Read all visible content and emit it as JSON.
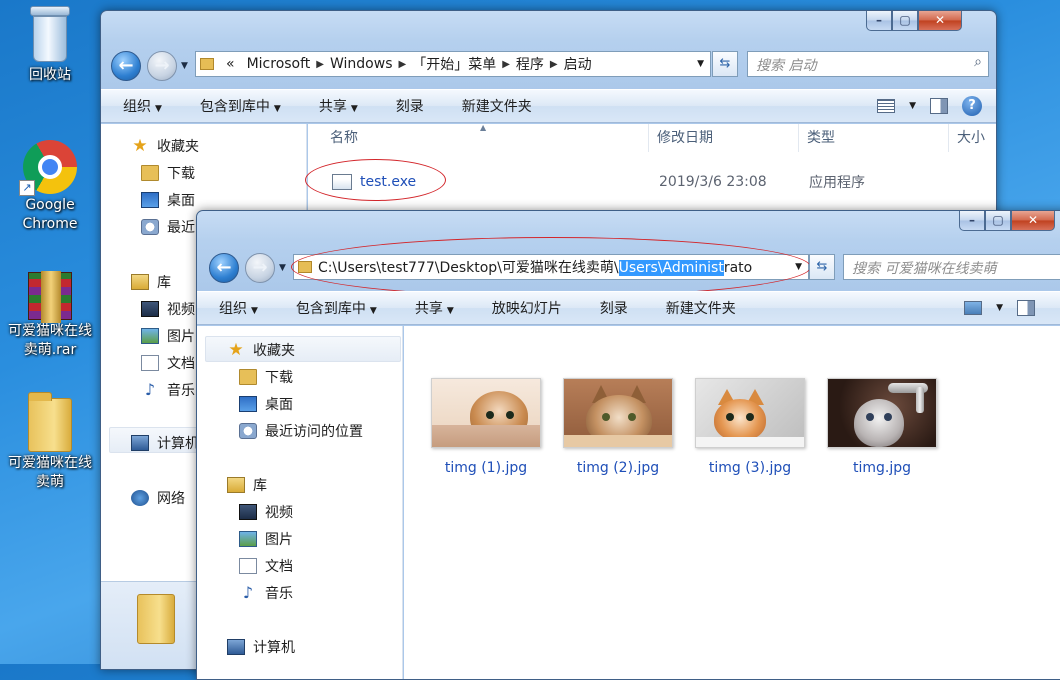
{
  "desktop": {
    "icons": [
      {
        "label": "回收站"
      },
      {
        "label": "Google Chrome"
      },
      {
        "label": "可爱猫咪在线卖萌.rar"
      },
      {
        "label": "可爱猫咪在线卖萌"
      }
    ]
  },
  "window_back": {
    "breadcrumb": [
      "«",
      "Microsoft",
      "Windows",
      "「开始」菜单",
      "程序",
      "启动"
    ],
    "search_placeholder": "搜索 启动",
    "toolbar": [
      "组织",
      "包含到库中",
      "共享",
      "刻录",
      "新建文件夹"
    ],
    "nav": [
      {
        "label": "收藏夹",
        "icon": "star-icon"
      },
      {
        "label": "下载",
        "icon": "folder-icon"
      },
      {
        "label": "桌面",
        "icon": "desktop-icon"
      },
      {
        "label": "最近",
        "icon": "recent-places-icon"
      },
      {
        "label": "库",
        "icon": "library-icon"
      },
      {
        "label": "视频",
        "icon": "video-icon"
      },
      {
        "label": "图片",
        "icon": "pictures-icon"
      },
      {
        "label": "文档",
        "icon": "documents-icon"
      },
      {
        "label": "音乐",
        "icon": "music-icon"
      },
      {
        "label": "计算机",
        "icon": "computer-icon"
      },
      {
        "label": "网络",
        "icon": "network-icon"
      }
    ],
    "columns": [
      "名称",
      "修改日期",
      "类型",
      "大小"
    ],
    "files": [
      {
        "name": "test.exe",
        "modified": "2019/3/6 23:08",
        "type": "应用程序"
      }
    ]
  },
  "window_front": {
    "address": {
      "prefix": "C:\\Users\\test777\\Desktop\\可爱猫咪在线卖萌\\",
      "selected": "Users\\Administ",
      "suffix": "rato"
    },
    "search_placeholder": "搜索 可爱猫咪在线卖萌",
    "toolbar": [
      "组织",
      "包含到库中",
      "共享",
      "放映幻灯片",
      "刻录",
      "新建文件夹"
    ],
    "nav": [
      {
        "label": "收藏夹",
        "icon": "star-icon"
      },
      {
        "label": "下载",
        "icon": "folder-icon"
      },
      {
        "label": "桌面",
        "icon": "desktop-icon"
      },
      {
        "label": "最近访问的位置",
        "icon": "recent-places-icon"
      },
      {
        "label": "库",
        "icon": "library-icon"
      },
      {
        "label": "视频",
        "icon": "video-icon"
      },
      {
        "label": "图片",
        "icon": "pictures-icon"
      },
      {
        "label": "文档",
        "icon": "documents-icon"
      },
      {
        "label": "音乐",
        "icon": "music-icon"
      },
      {
        "label": "计算机",
        "icon": "computer-icon"
      }
    ],
    "files": [
      {
        "name": "timg (1).jpg"
      },
      {
        "name": "timg (2).jpg"
      },
      {
        "name": "timg (3).jpg"
      },
      {
        "name": "timg.jpg"
      }
    ]
  },
  "colors": {
    "annotation_red": "#d3262b",
    "selection_blue": "#3399ff",
    "link_blue": "#1f4fb8"
  }
}
